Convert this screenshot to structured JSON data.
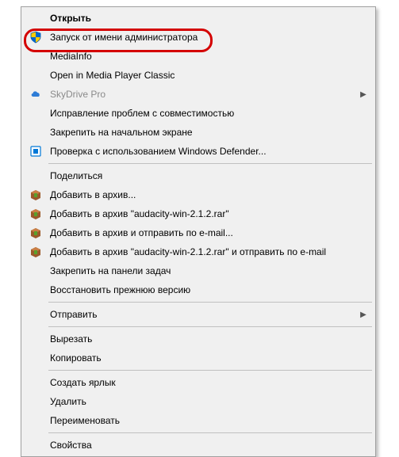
{
  "menu": {
    "open": "Открыть",
    "run_as_admin": "Запуск от имени администратора",
    "mediainfo": "MediaInfo",
    "open_mpc": "Open in Media Player Classic",
    "skydrive": "SkyDrive Pro",
    "compat_troubleshoot": "Исправление проблем с совместимостью",
    "pin_start": "Закрепить на начальном экране",
    "defender_scan": "Проверка с использованием Windows Defender...",
    "share": "Поделиться",
    "add_archive": "Добавить в архив...",
    "add_archive_named": "Добавить в архив \"audacity-win-2.1.2.rar\"",
    "add_archive_email": "Добавить в архив и отправить по e-mail...",
    "add_archive_named_email": "Добавить в архив \"audacity-win-2.1.2.rar\" и отправить по e-mail",
    "pin_taskbar": "Закрепить на панели задач",
    "restore_prev": "Восстановить прежнюю версию",
    "send_to": "Отправить",
    "cut": "Вырезать",
    "copy": "Копировать",
    "create_shortcut": "Создать ярлык",
    "delete": "Удалить",
    "rename": "Переименовать",
    "properties": "Свойства"
  }
}
